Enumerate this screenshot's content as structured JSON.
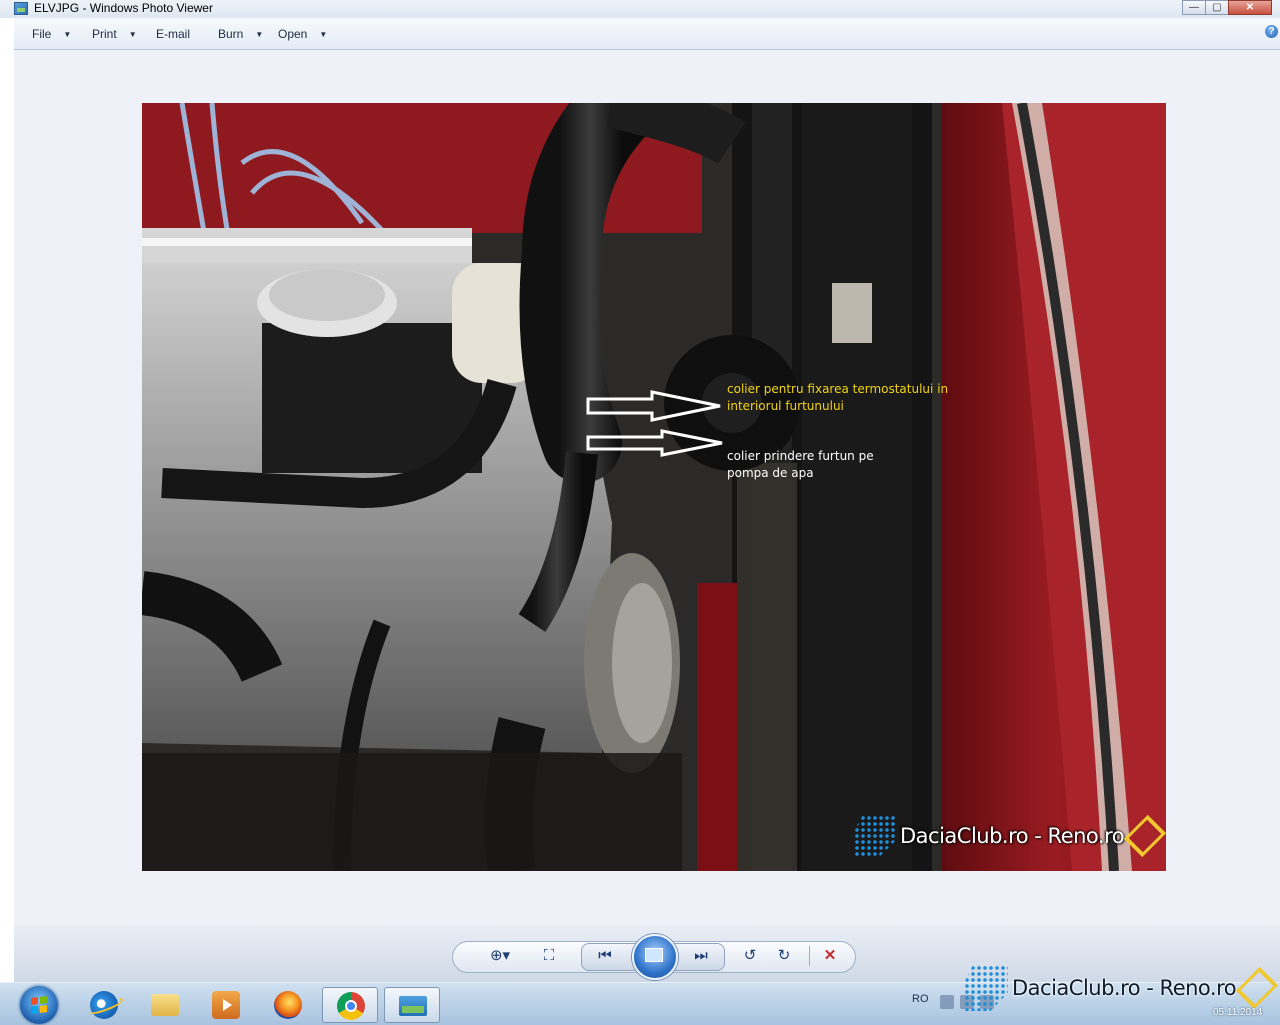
{
  "window": {
    "title": "ELVJPG - Windows Photo Viewer",
    "controls": {
      "minimize": "—",
      "maximize": "▢",
      "close": "✕"
    }
  },
  "menu": {
    "items": [
      {
        "label": "File",
        "has_dropdown": true
      },
      {
        "label": "Print",
        "has_dropdown": true
      },
      {
        "label": "E-mail",
        "has_dropdown": false
      },
      {
        "label": "Burn",
        "has_dropdown": true
      },
      {
        "label": "Open",
        "has_dropdown": true
      }
    ],
    "help_icon": "?"
  },
  "photo": {
    "annotations": {
      "yellow": "colier pentru fixarea termostatului in interiorul furtunului",
      "white": "colier prindere furtun pe pompa de apa"
    },
    "watermark": "DaciaClub.ro - Reno.ro"
  },
  "toolbar": {
    "buttons": [
      {
        "name": "zoom",
        "icon": "zoom-icon",
        "glyph": "⊕▾"
      },
      {
        "name": "actual-size",
        "icon": "actual-size-icon",
        "glyph": "⛶"
      },
      {
        "name": "previous",
        "icon": "previous-icon",
        "glyph": "⏮"
      },
      {
        "name": "slideshow",
        "icon": "slideshow-icon"
      },
      {
        "name": "next",
        "icon": "next-icon",
        "glyph": "⏭"
      },
      {
        "name": "rotate-ccw",
        "icon": "rotate-counterclockwise-icon",
        "glyph": "↺"
      },
      {
        "name": "rotate-cw",
        "icon": "rotate-clockwise-icon",
        "glyph": "↻"
      },
      {
        "name": "delete",
        "icon": "delete-icon",
        "glyph": "✕"
      }
    ],
    "delete_color": "#c62b2b"
  },
  "taskbar": {
    "pinned": [
      "internet-explorer-icon",
      "windows-explorer-icon",
      "media-player-icon",
      "firefox-icon",
      "chrome-icon",
      "photo-viewer-icon"
    ],
    "language": "RO",
    "tray_watermark": "DaciaClub.ro - Reno.ro",
    "clock": "05.11.2014"
  }
}
